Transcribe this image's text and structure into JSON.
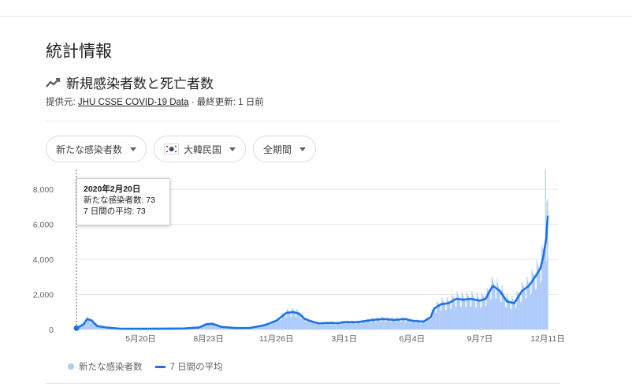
{
  "section_title": "統計情報",
  "chart_title": "新規感染者数と死亡者数",
  "source": {
    "prefix": "提供元: ",
    "link": "JHU CSSE COVID-19 Data",
    "suffix": " · 最終更新: 1 日前"
  },
  "filters": {
    "metric": "新たな感染者数",
    "region": "大韓民国",
    "period": "全期間"
  },
  "tooltip": {
    "date": "2020年2月20日",
    "new_cases": "新たな感染者数: 73",
    "avg": "7 日間の平均: 73"
  },
  "legend": {
    "bars": "新たな感染者数",
    "line": "7 日間の平均"
  },
  "colors": {
    "bars": "#aecbfa",
    "line": "#1a73e8",
    "grid": "#e8e8e8",
    "axis_text": "#5f6368"
  },
  "chart_data": {
    "type": "area",
    "title": "",
    "xlabel": "",
    "ylabel": "",
    "ylim": [
      0,
      9000
    ],
    "yticks": [
      0,
      2000,
      4000,
      6000,
      8000
    ],
    "ytick_labels": [
      "0",
      "2,000",
      "4,000",
      "6,000",
      "8,000"
    ],
    "x_tick_labels": [
      "5月20日",
      "8月23日",
      "11月26日",
      "3月1日",
      "6月4日",
      "9月7日",
      "12月11日"
    ],
    "x_tick_dates": [
      "2020-05-20",
      "2020-08-23",
      "2020-11-26",
      "2021-03-01",
      "2021-06-04",
      "2021-09-07",
      "2021-12-11"
    ],
    "x_range": [
      "2020-02-20",
      "2021-12-11"
    ],
    "highlight": {
      "date": "2020-02-20",
      "value": 73
    },
    "series": [
      {
        "name": "7 日間の平均",
        "style": "line",
        "x": [
          "2020-02-20",
          "2020-03-01",
          "2020-03-06",
          "2020-03-12",
          "2020-03-20",
          "2020-04-01",
          "2020-04-20",
          "2020-05-20",
          "2020-06-20",
          "2020-07-20",
          "2020-08-10",
          "2020-08-20",
          "2020-08-28",
          "2020-09-10",
          "2020-10-01",
          "2020-10-20",
          "2020-11-10",
          "2020-11-26",
          "2020-12-10",
          "2020-12-20",
          "2020-12-28",
          "2021-01-05",
          "2021-01-15",
          "2021-01-25",
          "2021-02-10",
          "2021-02-20",
          "2021-03-01",
          "2021-03-20",
          "2021-04-10",
          "2021-04-25",
          "2021-05-10",
          "2021-05-25",
          "2021-06-04",
          "2021-06-20",
          "2021-06-30",
          "2021-07-05",
          "2021-07-15",
          "2021-07-25",
          "2021-08-05",
          "2021-08-15",
          "2021-08-25",
          "2021-09-07",
          "2021-09-15",
          "2021-09-25",
          "2021-10-05",
          "2021-10-15",
          "2021-10-25",
          "2021-11-05",
          "2021-11-15",
          "2021-11-25",
          "2021-12-01",
          "2021-12-05",
          "2021-12-09",
          "2021-12-11"
        ],
        "values": [
          73,
          300,
          600,
          520,
          200,
          120,
          50,
          40,
          50,
          60,
          120,
          300,
          330,
          150,
          80,
          90,
          250,
          500,
          950,
          1000,
          900,
          600,
          450,
          350,
          380,
          360,
          420,
          420,
          550,
          600,
          550,
          600,
          500,
          450,
          700,
          1200,
          1450,
          1500,
          1750,
          1700,
          1750,
          1650,
          1750,
          2500,
          2200,
          1600,
          1500,
          2200,
          2500,
          3100,
          3500,
          4200,
          5200,
          6500
        ]
      },
      {
        "name": "新たな感染者数",
        "style": "bars",
        "peak": {
          "date": "2021-12-08",
          "value": 9200
        }
      }
    ]
  }
}
